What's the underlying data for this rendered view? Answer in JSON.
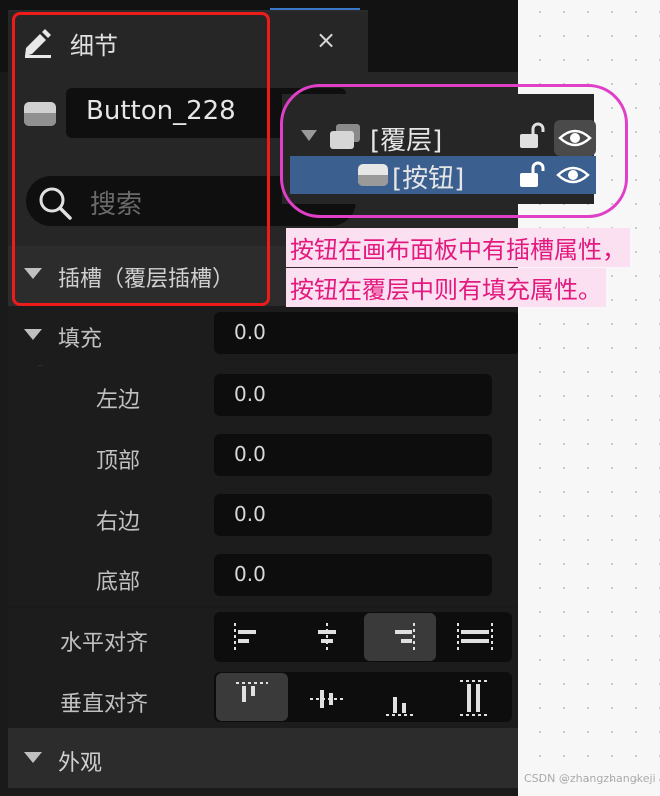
{
  "tab": {
    "title": "细节",
    "close": "×",
    "edit_icon": "pencil-edit-icon"
  },
  "name_field": {
    "value": "Button_228",
    "icon": "button-widget-icon"
  },
  "search": {
    "placeholder": "搜索",
    "icon": "search-icon"
  },
  "sections": {
    "slot": "插槽（覆层插槽）",
    "appearance": "外观"
  },
  "padding": {
    "label": "填充",
    "value": "0.0",
    "left": {
      "label": "左边",
      "value": "0.0"
    },
    "top": {
      "label": "顶部",
      "value": "0.0"
    },
    "right": {
      "label": "右边",
      "value": "0.0"
    },
    "bottom": {
      "label": "底部",
      "value": "0.0"
    }
  },
  "horizontal_alignment": {
    "label": "水平对齐",
    "options": [
      "align-left",
      "align-center",
      "align-right",
      "fill"
    ],
    "selected": "align-right"
  },
  "vertical_alignment": {
    "label": "垂直对齐",
    "options": [
      "align-top",
      "align-center",
      "align-bottom",
      "fill"
    ],
    "selected": "align-top"
  },
  "hierarchy": {
    "overlay": {
      "label": "[覆层]",
      "icon": "overlay-icon"
    },
    "button": {
      "label": "[按钮]",
      "icon": "button-widget-icon"
    }
  },
  "annotation": {
    "line1": "按钮在画布面板中有插槽属性，",
    "line2": "按钮在覆层中则有填充属性。"
  },
  "watermark": "CSDN @zhangzhangkeji",
  "colors": {
    "selection": "#3b5f8f",
    "annotation_text": "#e3197e",
    "annotation_bg": "#fbe0f2",
    "red_outline": "#ee1b1b",
    "pink_outline": "#e040c8"
  }
}
